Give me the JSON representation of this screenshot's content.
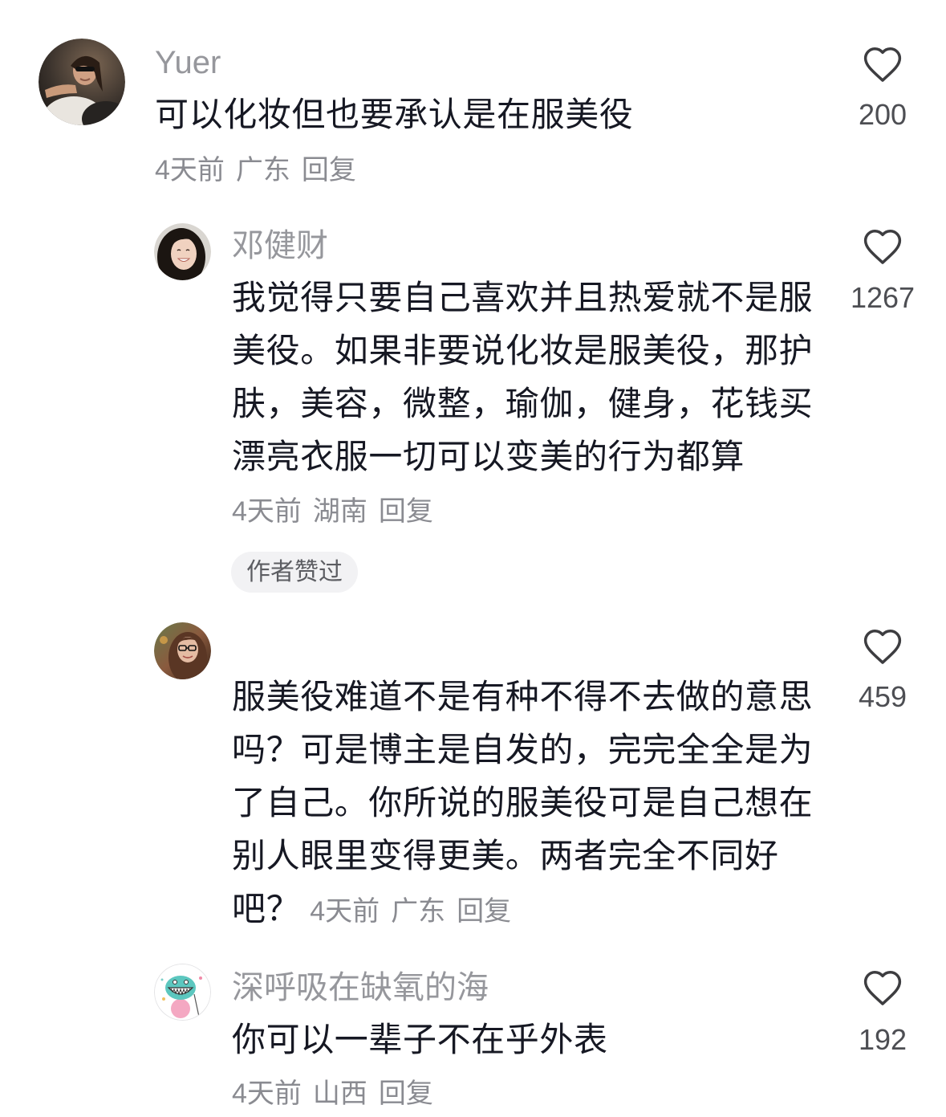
{
  "colors": {
    "text_primary": "#161823",
    "text_secondary": "#8a8b91",
    "username": "#96979c",
    "like_count": "#4d4e53",
    "icon": "#3d3d40",
    "badge_background": "#f2f2f4"
  },
  "icons": {
    "like": "heart-outline-icon",
    "avatar": "user-avatar-photo"
  },
  "comments": [
    {
      "username": "Yuer",
      "text": "可以化妆但也要承认是在服美役",
      "time": "4天前",
      "location": "广东",
      "reply": "回复",
      "likes": "200"
    },
    {
      "username": "邓健财",
      "text": "我觉得只要自己喜欢并且热爱就不是服美役。如果非要说化妆是服美役，那护肤，美容，微整，瑜伽，健身，花钱买漂亮衣服一切可以变美的行为都算",
      "time": "4天前",
      "location": "湖南",
      "reply": "回复",
      "likes": "1267",
      "badge": "作者赞过"
    },
    {
      "text": "服美役难道不是有种不得不去做的意思吗？可是博主是自发的，完完全全是为了自己。你所说的服美役可是自己想在别人眼里变得更美。两者完全不同好吧？",
      "time": "4天前",
      "location": "广东",
      "reply": "回复",
      "likes": "459"
    },
    {
      "username": "深呼吸在缺氧的海",
      "text": "你可以一辈子不在乎外表",
      "time": "4天前",
      "location": "山西",
      "reply": "回复",
      "likes": "192"
    }
  ]
}
